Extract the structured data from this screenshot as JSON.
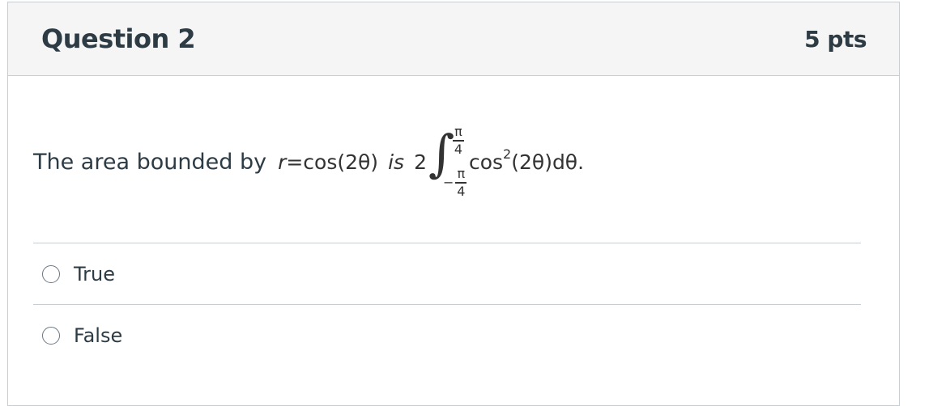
{
  "question": {
    "title": "Question 2",
    "points": "5 pts",
    "lead_text": "The area bounded by",
    "math": {
      "r_var": "r",
      "equals_expr": "=cos(2θ)",
      "is_word": "is",
      "coefficient": "2",
      "integral_sign": "∫",
      "upper_num": "π",
      "upper_den": "4",
      "lower_minus": "−",
      "lower_num": "π",
      "lower_den": "4",
      "integrand_cos": "cos",
      "exponent": "2",
      "integrand_rest": "(2θ)dθ."
    }
  },
  "answers": [
    {
      "label": "True",
      "selected": false
    },
    {
      "label": "False",
      "selected": false
    }
  ]
}
